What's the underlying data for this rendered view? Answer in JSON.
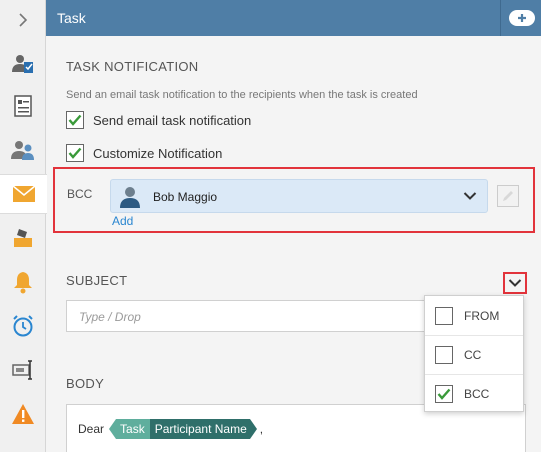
{
  "rail": {
    "items": [
      {
        "icon": "chevron-right-icon"
      },
      {
        "icon": "user-task-icon"
      },
      {
        "icon": "form-document-icon"
      },
      {
        "icon": "users-icon"
      },
      {
        "icon": "envelope-icon",
        "active": true
      },
      {
        "icon": "inbox-tray-icon"
      },
      {
        "icon": "bell-icon"
      },
      {
        "icon": "alarm-clock-icon"
      },
      {
        "icon": "text-field-icon"
      },
      {
        "icon": "warning-icon"
      }
    ]
  },
  "header": {
    "title": "Task",
    "add_icon": "plus-icon"
  },
  "notification": {
    "section_title": "TASK NOTIFICATION",
    "description": "Send an email task notification to the recipients when the task is created",
    "send_email_label": "Send email task notification",
    "send_email_checked": true,
    "customize_label": "Customize Notification",
    "customize_checked": true
  },
  "bcc": {
    "label": "BCC",
    "recipient_name": "Bob Maggio",
    "add_label": "Add"
  },
  "subject": {
    "section_title": "SUBJECT",
    "placeholder": "Type / Drop"
  },
  "body": {
    "section_title": "BODY",
    "greeting": "Dear",
    "token_category": "Task",
    "token_field": "Participant Name",
    "trailing": ","
  },
  "dropdown": {
    "options": [
      {
        "label": "FROM",
        "checked": false
      },
      {
        "label": "CC",
        "checked": false
      },
      {
        "label": "BCC",
        "checked": true
      }
    ]
  },
  "colors": {
    "header": "#4f7ea6",
    "highlight": "#e2333b",
    "link": "#2a86d0",
    "check": "#3a9a3a",
    "token_light": "#5fae9d",
    "token_dark": "#2f6f6a"
  }
}
